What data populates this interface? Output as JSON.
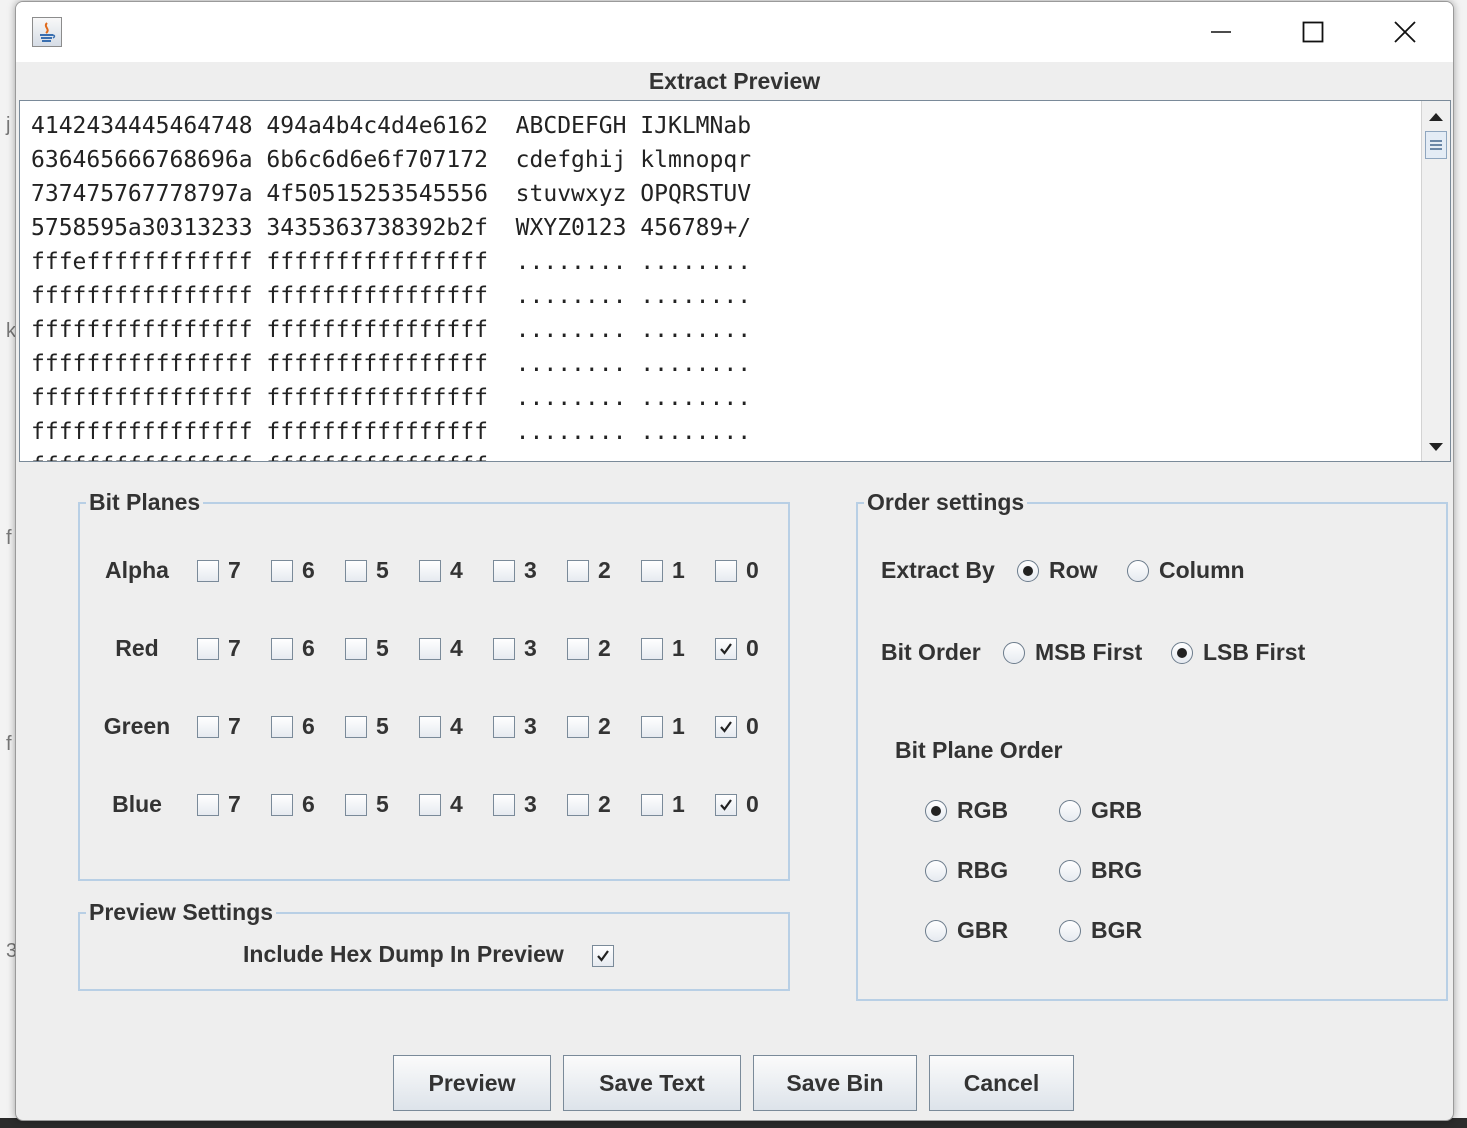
{
  "window": {
    "title": "Extract Preview",
    "controls": {
      "minimize": "minimize-icon",
      "maximize": "maximize-icon",
      "close": "close-icon"
    }
  },
  "preview": {
    "lines": [
      "4142434445464748 494a4b4c4d4e6162  ABCDEFGH IJKLMNab",
      "636465666768696a 6b6c6d6e6f707172  cdefghij klmnopqr",
      "737475767778797a 4f50515253545556  stuvwxyz OPQRSTUV",
      "5758595a30313233 3435363738392b2f  WXYZ0123 456789+/",
      "fffeffffffffffff ffffffffffffffff  ........ ........",
      "ffffffffffffffff ffffffffffffffff  ........ ........",
      "ffffffffffffffff ffffffffffffffff  ........ ........",
      "ffffffffffffffff ffffffffffffffff  ........ ........",
      "ffffffffffffffff ffffffffffffffff  ........ ........",
      "ffffffffffffffff ffffffffffffffff  ........ ........",
      "ffffffffffffffff ffffffffffffffff  ........ ........"
    ]
  },
  "bit_planes": {
    "title": "Bit Planes",
    "bits": [
      "7",
      "6",
      "5",
      "4",
      "3",
      "2",
      "1",
      "0"
    ],
    "rows": [
      {
        "label": "Alpha",
        "checked": [
          false,
          false,
          false,
          false,
          false,
          false,
          false,
          false
        ]
      },
      {
        "label": "Red",
        "checked": [
          false,
          false,
          false,
          false,
          false,
          false,
          false,
          true
        ]
      },
      {
        "label": "Green",
        "checked": [
          false,
          false,
          false,
          false,
          false,
          false,
          false,
          true
        ]
      },
      {
        "label": "Blue",
        "checked": [
          false,
          false,
          false,
          false,
          false,
          false,
          false,
          true
        ]
      }
    ]
  },
  "preview_settings": {
    "title": "Preview Settings",
    "hex_dump_label": "Include Hex Dump In Preview",
    "hex_dump_checked": true
  },
  "order_settings": {
    "title": "Order settings",
    "extract_by": {
      "label": "Extract By",
      "options": [
        "Row",
        "Column"
      ],
      "selected": "Row"
    },
    "bit_order": {
      "label": "Bit Order",
      "options": [
        "MSB First",
        "LSB First"
      ],
      "selected": "LSB First"
    },
    "bit_plane_order": {
      "label": "Bit Plane Order",
      "options": [
        "RGB",
        "GRB",
        "RBG",
        "BRG",
        "GBR",
        "BGR"
      ],
      "selected": "RGB"
    }
  },
  "buttons": {
    "preview": "Preview",
    "save_text": "Save Text",
    "save_bin": "Save Bin",
    "cancel": "Cancel"
  }
}
